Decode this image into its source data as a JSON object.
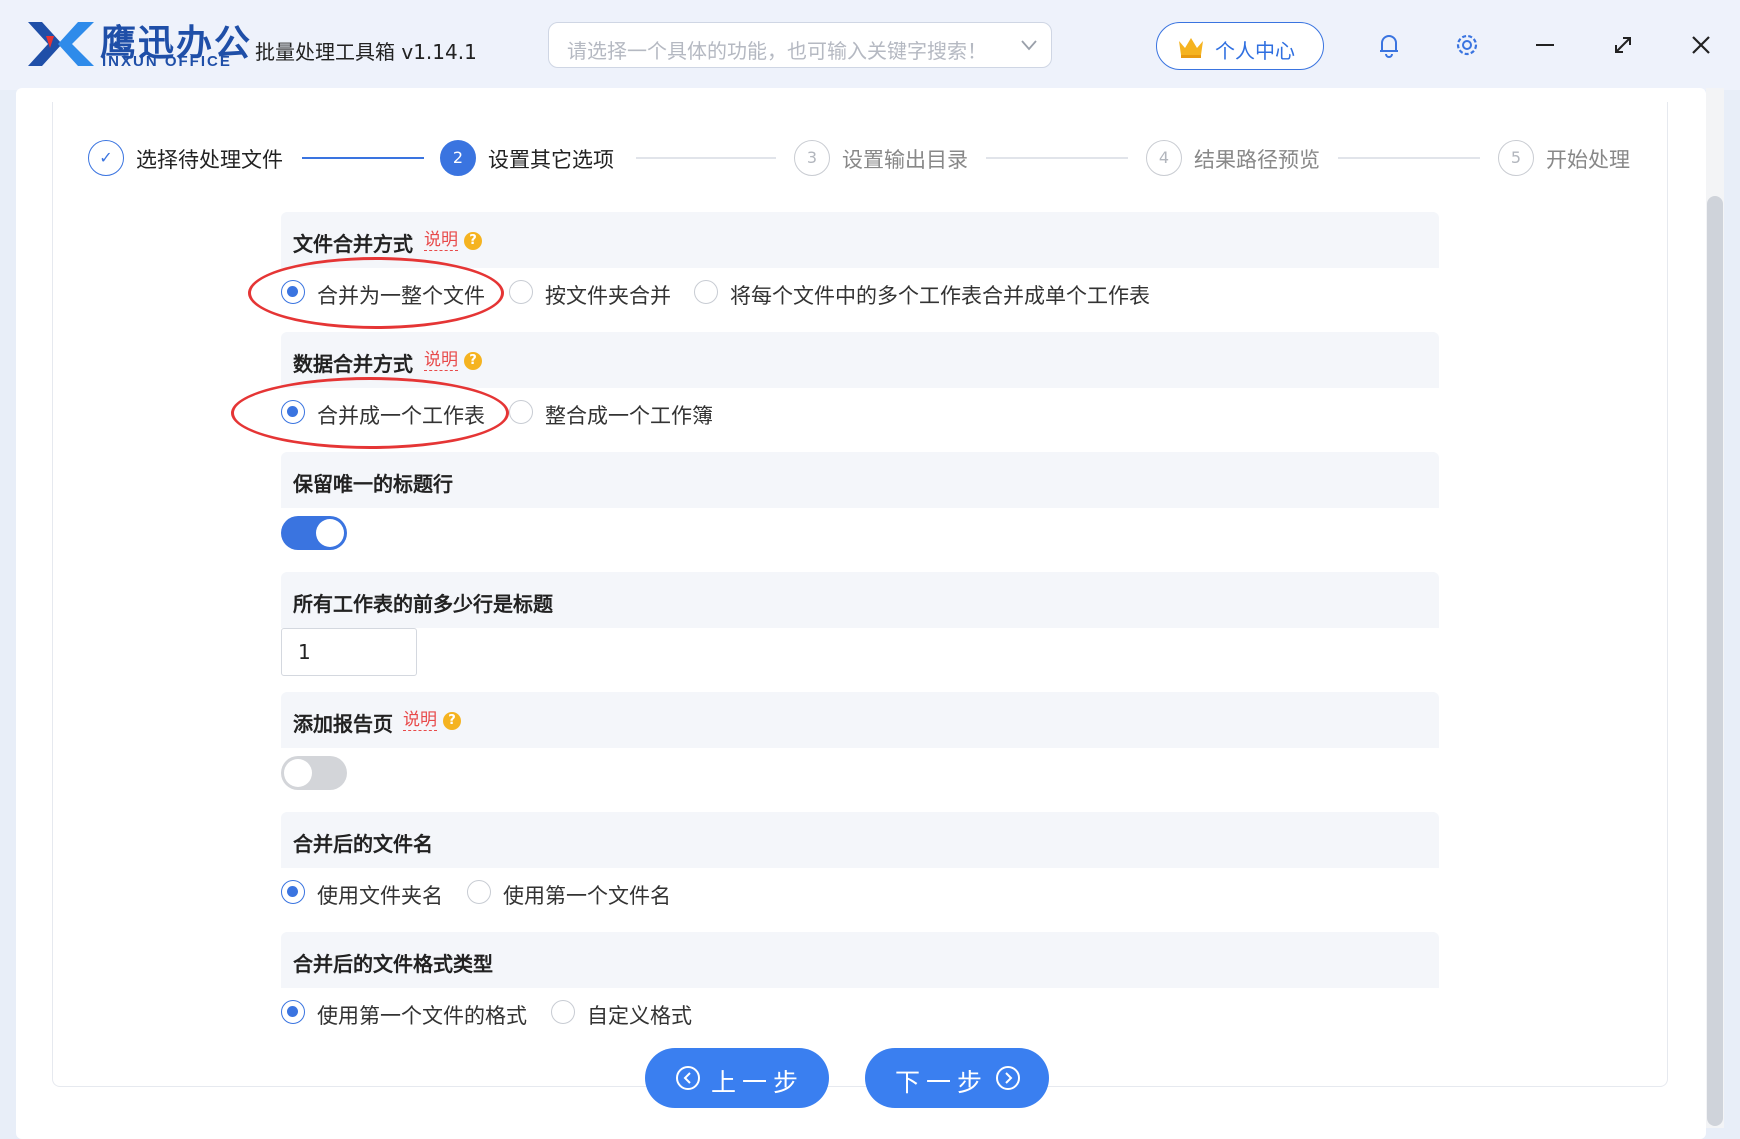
{
  "app": {
    "brand_name": "鹰迅办公",
    "brand_sub": "INXUN OFFICE",
    "title": "批量处理工具箱 v1.14.1"
  },
  "search": {
    "placeholder": "请选择一个具体的功能，也可输入关键字搜索！"
  },
  "header": {
    "user_center_label": "个人中心"
  },
  "steps": [
    {
      "number": "✓",
      "label": "选择待处理文件",
      "state": "done"
    },
    {
      "number": "2",
      "label": "设置其它选项",
      "state": "active"
    },
    {
      "number": "3",
      "label": "设置输出目录",
      "state": "pending"
    },
    {
      "number": "4",
      "label": "结果路径预览",
      "state": "pending"
    },
    {
      "number": "5",
      "label": "开始处理",
      "state": "pending"
    }
  ],
  "sections": {
    "file_merge": {
      "title": "文件合并方式",
      "help": "说明",
      "options": [
        "合并为一整个文件",
        "按文件夹合并",
        "将每个文件中的多个工作表合并成单个工作表"
      ],
      "selected_index": 0
    },
    "data_merge": {
      "title": "数据合并方式",
      "help": "说明",
      "options": [
        "合并成一个工作表",
        "整合成一个工作簿"
      ],
      "selected_index": 0
    },
    "unique_header": {
      "title": "保留唯一的标题行",
      "toggle": "on"
    },
    "header_rows": {
      "title": "所有工作表的前多少行是标题",
      "value": "1"
    },
    "report_page": {
      "title": "添加报告页",
      "help": "说明",
      "toggle": "off"
    },
    "merged_name": {
      "title": "合并后的文件名",
      "options": [
        "使用文件夹名",
        "使用第一个文件名"
      ],
      "selected_index": 0
    },
    "merged_format": {
      "title": "合并后的文件格式类型",
      "options": [
        "使用第一个文件的格式",
        "自定义格式"
      ],
      "selected_index": 0
    }
  },
  "buttons": {
    "prev": "上一步",
    "next": "下一步"
  },
  "colors": {
    "accent": "#3a74e0",
    "highlight": "#e53535",
    "help_link": "#e84a4a"
  }
}
